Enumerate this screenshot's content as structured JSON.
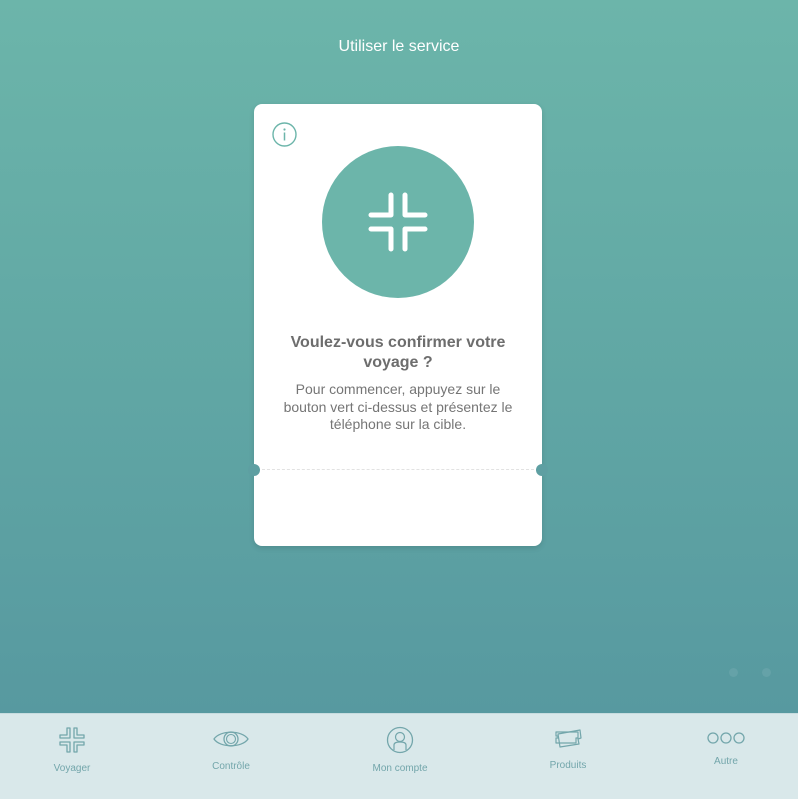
{
  "header": {
    "title": "Utiliser le service"
  },
  "card": {
    "info_icon": "info-icon",
    "validate_icon": "validate-arrows-icon",
    "title": "Voulez-vous confirmer votre voyage ?",
    "text": "Pour commencer, appuyez sur le bouton vert ci-dessus et présentez le téléphone sur la cible."
  },
  "tabs": [
    {
      "label": "Voyager",
      "icon": "voyager-icon"
    },
    {
      "label": "Contrôle",
      "icon": "eye-icon"
    },
    {
      "label": "Mon compte",
      "icon": "user-icon"
    },
    {
      "label": "Produits",
      "icon": "tickets-icon"
    },
    {
      "label": "Autre",
      "icon": "more-icon"
    }
  ],
  "colors": {
    "accent": "#6cb5aa",
    "background_top": "#6cb5aa",
    "background_bottom": "#5799a0",
    "tabbar": "#d9e8ea",
    "tab_icon": "#73a6ab",
    "text": "#757575"
  }
}
